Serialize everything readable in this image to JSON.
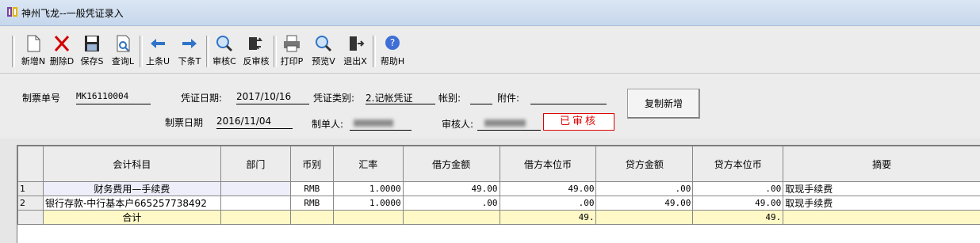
{
  "window": {
    "title": "神州飞龙--一般凭证录入"
  },
  "toolbar": {
    "buttons": [
      {
        "name": "new-button",
        "label": "新增N",
        "icon": "new-doc-icon"
      },
      {
        "name": "delete-button",
        "label": "删除D",
        "icon": "red-x-icon"
      },
      {
        "name": "save-button",
        "label": "保存S",
        "icon": "floppy-icon"
      },
      {
        "name": "query-button",
        "label": "查询L",
        "icon": "doc-search-icon"
      },
      {
        "name": "prev-button",
        "label": "上条U",
        "icon": "arrow-left-icon"
      },
      {
        "name": "next-button",
        "label": "下条T",
        "icon": "arrow-right-icon"
      },
      {
        "name": "audit-button",
        "label": "审核C",
        "icon": "magnifier-icon"
      },
      {
        "name": "unaudit-button",
        "label": "反审核",
        "icon": "reverse-icon"
      },
      {
        "name": "print-button",
        "label": "打印P",
        "icon": "printer-icon"
      },
      {
        "name": "preview-button",
        "label": "预览V",
        "icon": "magnifier-icon"
      },
      {
        "name": "exit-button",
        "label": "退出X",
        "icon": "exit-door-icon"
      },
      {
        "name": "help-button",
        "label": "帮助H",
        "icon": "help-circle-icon"
      }
    ]
  },
  "form": {
    "ticket_no_label": "制票单号",
    "ticket_no": "MK16110004",
    "voucher_date_label": "凭证日期:",
    "voucher_date": "2017/10/16",
    "voucher_type_label": "凭证类别:",
    "voucher_type": "2.记帐凭证",
    "account_label": "帐别:",
    "account": "",
    "attachment_label": "附件:",
    "attachment": "",
    "created_date_label": "制票日期",
    "created_date": "2016/11/04",
    "creator_label": "制单人:",
    "auditor_label": "审核人:",
    "status_stamp": "已审核",
    "copy_new_label": "复制新增"
  },
  "grid": {
    "headers": [
      "会计科目",
      "部门",
      "币别",
      "汇率",
      "借方金额",
      "借方本位币",
      "贷方金额",
      "贷方本位币",
      "摘要"
    ],
    "rows": [
      {
        "idx": "1",
        "subject": "财务费用—手续费",
        "dept": "",
        "currency": "RMB",
        "rate": "1.0000",
        "debit": "49.00",
        "debit_base": "49.00",
        "credit": ".00",
        "credit_base": ".00",
        "summary": "取现手续费"
      },
      {
        "idx": "2",
        "subject": "银行存款-中行基本户665257738492",
        "dept": "",
        "currency": "RMB",
        "rate": "1.0000",
        "debit": ".00",
        "debit_base": ".00",
        "credit": "49.00",
        "credit_base": "49.00",
        "summary": "取现手续费"
      }
    ],
    "total": {
      "label": "合计",
      "debit_base": "49.",
      "credit_base": "49."
    }
  },
  "colors": {
    "stamp": "#e00000",
    "total_row": "#fff9c8",
    "titlebar": "#c6d7ec"
  }
}
